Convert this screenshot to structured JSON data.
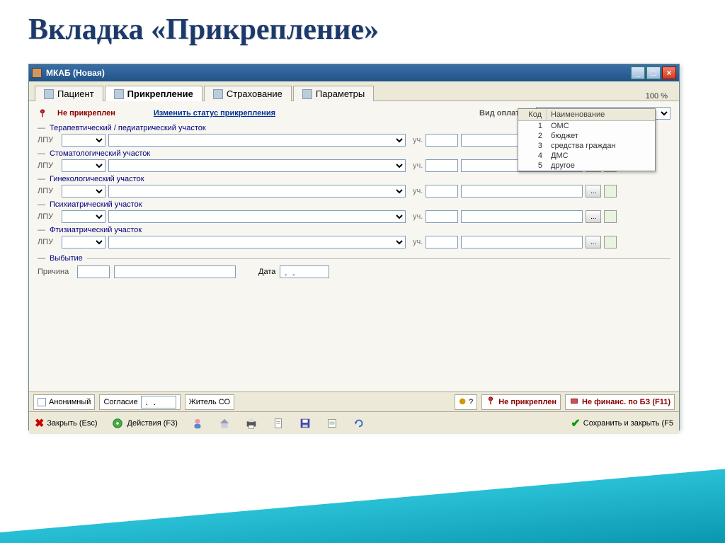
{
  "slide": {
    "title": "Вкладка «Прикрепление»"
  },
  "window": {
    "title": "МКАБ (Новая)",
    "zoom": "100 %"
  },
  "tabs": [
    {
      "label": "Пациент"
    },
    {
      "label": "Прикрепление"
    },
    {
      "label": "Страхование"
    },
    {
      "label": "Параметры"
    }
  ],
  "status": {
    "not_attached": "Не прикреплен",
    "change_link": "Изменить статус прикрепления",
    "pay_label": "Вид оплаты"
  },
  "dropdown": {
    "head_code": "Код",
    "head_name": "Наименование",
    "rows": [
      {
        "code": "1",
        "name": "ОМС"
      },
      {
        "code": "2",
        "name": "бюджет"
      },
      {
        "code": "3",
        "name": "средства граждан"
      },
      {
        "code": "4",
        "name": "ДМС"
      },
      {
        "code": "5",
        "name": "другое"
      }
    ]
  },
  "sections": [
    {
      "title": "Терапевтический / педиатрический участок"
    },
    {
      "title": "Стоматологический участок"
    },
    {
      "title": "Гинекологический участок"
    },
    {
      "title": "Психиатрический участок"
    },
    {
      "title": "Фтизиатрический участок"
    }
  ],
  "labels": {
    "lpu": "ЛПУ",
    "uch": "уч.",
    "departure": "Выбытие",
    "reason": "Причина",
    "date": "Дата",
    "dots": "..."
  },
  "bottom": {
    "anon": "Анонимный",
    "consent": "Согласие",
    "resident": "Житель СО",
    "question": "?",
    "not_attached": "Не прикреплен",
    "not_financed": "Не финанс. по БЗ (F11)"
  },
  "actions": {
    "close": "Закрыть (Esc)",
    "actions": "Действия (F3)",
    "save": "Сохранить и закрыть (F5"
  }
}
